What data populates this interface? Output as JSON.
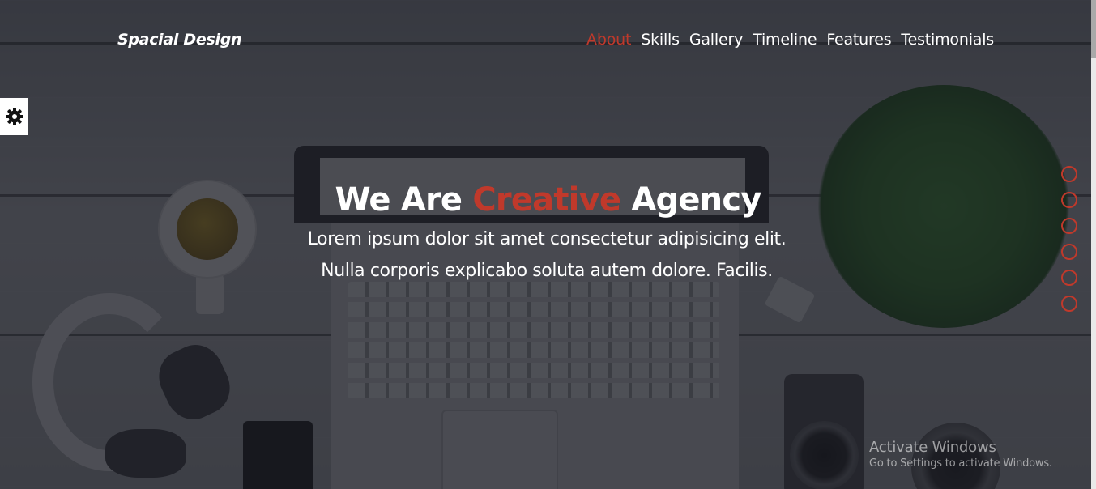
{
  "brand": "Spacial Design",
  "nav": {
    "items": [
      {
        "label": "About",
        "active": true
      },
      {
        "label": "Skills",
        "active": false
      },
      {
        "label": "Gallery",
        "active": false
      },
      {
        "label": "Timeline",
        "active": false
      },
      {
        "label": "Features",
        "active": false
      },
      {
        "label": "Testimonials",
        "active": false
      }
    ]
  },
  "settings": {
    "icon": "gear-icon"
  },
  "hero": {
    "title_prefix": "We Are ",
    "title_accent": "Creative",
    "title_suffix": " Agency",
    "text": "Lorem ipsum dolor sit amet consectetur adipisicing elit. Nulla corporis explicabo soluta autem dolore. Facilis."
  },
  "bullets": {
    "count": 6
  },
  "watermark": {
    "title": "Activate Windows",
    "subtitle": "Go to Settings to activate Windows."
  },
  "colors": {
    "accent": "#c0392b",
    "text": "#ffffff",
    "overlay": "#181a22"
  }
}
